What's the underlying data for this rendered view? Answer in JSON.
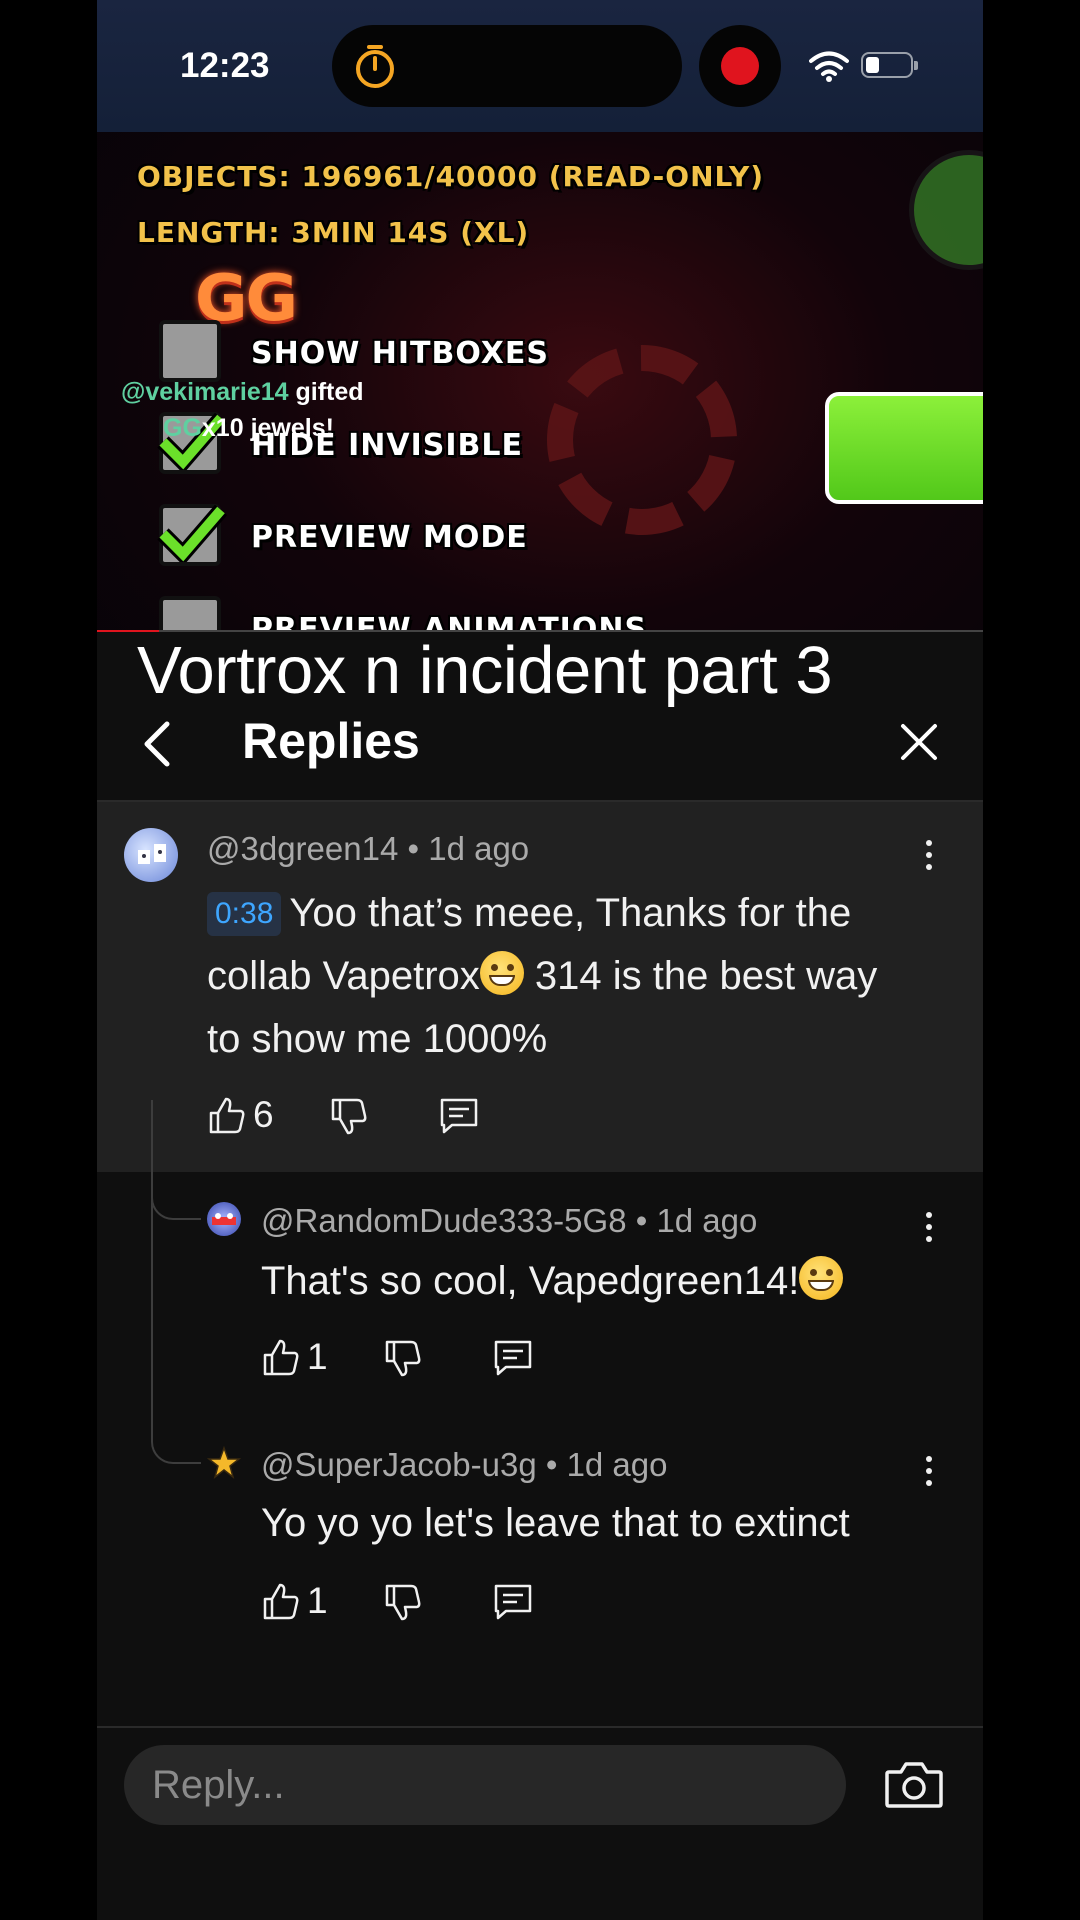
{
  "status_bar": {
    "time": "12:23"
  },
  "video": {
    "objects_line": "OBJECTS: 196961/40000 (READ-ONLY)",
    "length_line": "LENGTH: 3MIN 14S (XL)",
    "gg_badge": "GG",
    "options": [
      {
        "label": "SHOW HITBOXES",
        "checked": false
      },
      {
        "label": "HIDE INVISIBLE",
        "checked": true
      },
      {
        "label": "PREVIEW MODE",
        "checked": true
      },
      {
        "label": "PREVIEW ANIMATIONS",
        "checked": true
      }
    ],
    "gift": {
      "user": "@vekimarie14",
      "action": "gifted",
      "item": "GG",
      "count": "x10",
      "suffix": "jewels!"
    },
    "progress": 0.07
  },
  "overlay_title": "Vortrox n incident part 3",
  "header": {
    "title": "Replies"
  },
  "comments": [
    {
      "author": "@3dgreen14",
      "age": "1d ago",
      "timestamp_chip": "0:38",
      "text_1": "Yoo that’s meee, Thanks for the collab Vapetrox",
      "text_2": " 314 is the best way to show me 1000%",
      "likes": "6"
    },
    {
      "author": "@RandomDude333-5G8",
      "age": "1d ago",
      "text": "That's so cool, Vapedgreen14!",
      "likes": "1"
    },
    {
      "author": "@SuperJacob-u3g",
      "age": "1d ago",
      "text": "Yo yo yo let's leave that to extinct",
      "likes": "1"
    }
  ],
  "reply_bar": {
    "placeholder": "Reply..."
  },
  "colors": {
    "accent_red": "#e0141e",
    "link_blue": "#3ea6ff",
    "background": "#0f0f0f",
    "parent_bg": "#212121"
  }
}
